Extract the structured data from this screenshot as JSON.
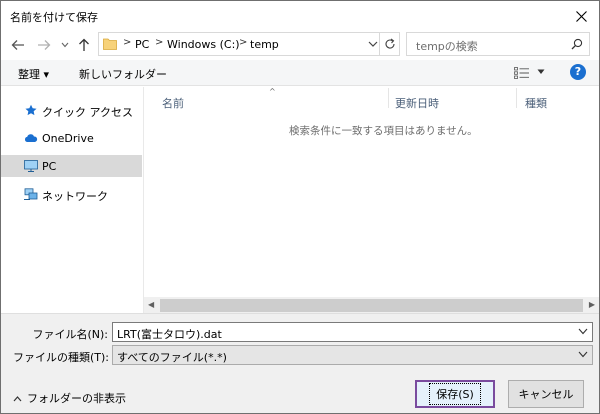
{
  "window": {
    "title": "名前を付けて保存"
  },
  "address": {
    "segments": [
      "PC",
      "Windows (C:)",
      "temp"
    ],
    "separator": ">"
  },
  "search": {
    "placeholder": "tempの検索"
  },
  "toolbar": {
    "organize_label": "整理 ▾",
    "new_folder_label": "新しいフォルダー",
    "help_label": "?"
  },
  "sidebar": {
    "items": [
      {
        "label": "クイック アクセス",
        "icon": "star-icon"
      },
      {
        "label": "OneDrive",
        "icon": "cloud-icon"
      },
      {
        "label": "PC",
        "icon": "computer-icon",
        "selected": true
      },
      {
        "label": "ネットワーク",
        "icon": "network-icon"
      }
    ]
  },
  "list": {
    "columns": [
      "名前",
      "更新日時",
      "種類"
    ],
    "sort_arrow": "^",
    "empty_message": "検索条件に一致する項目はありません。"
  },
  "form": {
    "filename_label": "ファイル名(N):",
    "filename_value": "LRT(富士タロウ).dat",
    "filetype_label": "ファイルの種類(T):",
    "filetype_value": "すべてのファイル(*.*)",
    "hide_folders_label": "フォルダーの非表示",
    "save_label": "保存(S)",
    "cancel_label": "キャンセル"
  },
  "colors": {
    "accent": "#1a6fd0",
    "primary_border": "#7a4b9e",
    "selected_bg": "#d9d9d9"
  }
}
